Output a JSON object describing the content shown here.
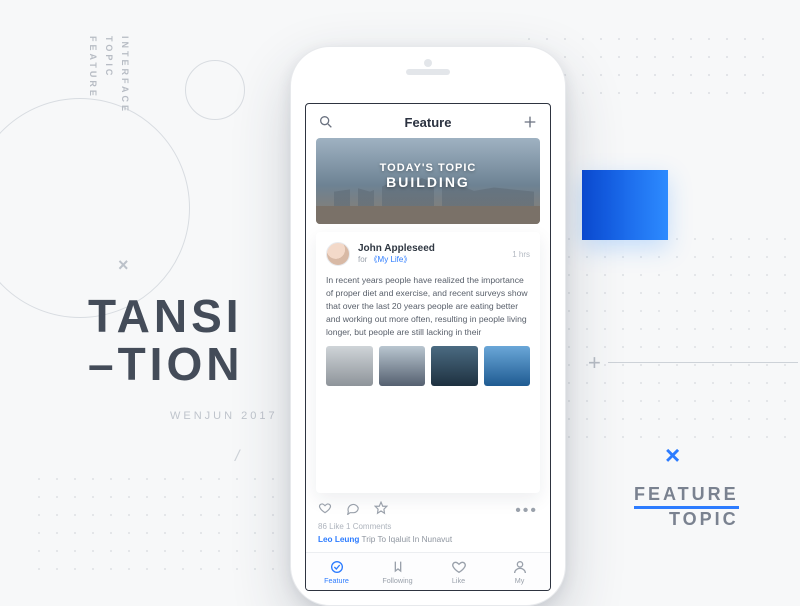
{
  "sidebar": {
    "labels": [
      "FEATURE",
      "TOPIC",
      "INTERFACE"
    ]
  },
  "headline": {
    "line1": "TANSI",
    "line2": "–TION"
  },
  "byline": "WENJUN 2017",
  "footer": {
    "line1": "FEATURE",
    "line2": "TOPIC"
  },
  "app": {
    "nav_title": "Feature",
    "hero": {
      "line1": "TODAY'S TOPIC",
      "line2": "BUILDING"
    },
    "post": {
      "author": "John Appleseed",
      "for_prefix": "for  ",
      "book": "《My Life》",
      "time": "1 hrs",
      "body": "In recent years people have realized the importance of proper diet and exercise, and recent surveys show that over the last 20 years people are eating better and working out more often, resulting in people living longer, but people are still lacking in their"
    },
    "stats": "86 Like   1 Comments",
    "related": {
      "who": "Leo Leung",
      "what": "Trip To Iqaluit In Nunavut"
    },
    "tabs": [
      "Feature",
      "Following",
      "Like",
      "My"
    ]
  }
}
